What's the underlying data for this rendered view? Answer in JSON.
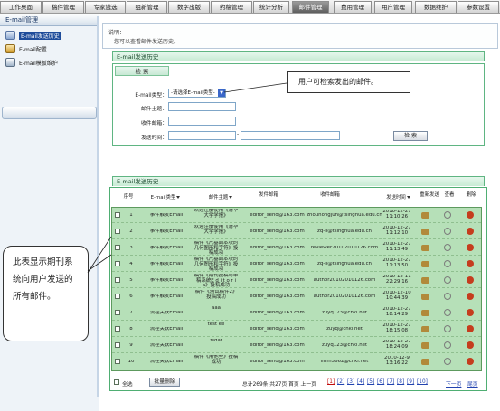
{
  "nav": {
    "tabs": [
      "工作桌面",
      "稿件管理",
      "专家遴选",
      "组新管理",
      "数字出版",
      "约稿管理",
      "统计分析",
      "邮件管理",
      "费用管理",
      "用户管理",
      "数据维护",
      "参数设置"
    ],
    "active": "邮件管理"
  },
  "sidebar": {
    "title": "E-mail管理",
    "items": [
      {
        "label": "E-mail发送历史",
        "icon": "history-icon",
        "active": true
      },
      {
        "label": "E-mail配置",
        "icon": "config-icon",
        "active": false
      },
      {
        "label": "E-mail模板维护",
        "icon": "template-icon",
        "active": false
      }
    ]
  },
  "notice": {
    "title": "说明：",
    "text": "您可以查看邮件发送历史。"
  },
  "section_title": "E-mail发送历史",
  "search": {
    "header": "检 索",
    "type_label": "E-mail类型：",
    "type_value": "-请选择E-mail类型-",
    "subject_label": "邮件主题：",
    "recipient_label": "收件邮箱：",
    "time_label": "发送时间：",
    "time_sep": "-",
    "button": "检 索"
  },
  "list": {
    "title": "E-mail发送历史",
    "headers": [
      "序号",
      "E-mail类型",
      "邮件主题",
      "发件邮箱",
      "收件邮箱",
      "发送时间",
      "重新发送",
      "查看",
      "删除"
    ],
    "rows": [
      {
        "no": "1",
        "type": "事件触发Email",
        "subject": "欢迎注册使用《清华大学学报》",
        "sender": "editor_send@163.com",
        "recipient": "zhouhongjun@tsinghua.edu.cn",
        "time": "2010-12-27 11:10:26"
      },
      {
        "no": "2",
        "type": "事件触发Email",
        "subject": "欢迎注册使用《清华大学学报》",
        "sender": "editor_send@163.com",
        "recipient": "zq-li@tsinghua.edu.cn",
        "time": "2010-12-27 11:12:10"
      },
      {
        "no": "3",
        "type": "事件触发Email",
        "subject": "稿件《尺基面本块的几何图形和字符》投稿成功",
        "sender": "editor_send@163.com",
        "recipient": "reviewer20102010126.com",
        "time": "2010-12-27 11:13:49"
      },
      {
        "no": "4",
        "type": "事件触发Email",
        "subject": "稿件《尺基面本块的几何图形和字符》投稿成功",
        "sender": "editor_send@163.com",
        "recipient": "zq-li@tsinghua.edu.cn",
        "time": "2010-12-27 11:13:50"
      },
      {
        "no": "5",
        "type": "事件触发Email",
        "subject": "稿件《期刊投稿与审稿系统E d i t o r i a》投稿成功",
        "sender": "editor_send@163.com",
        "recipient": "author20102010126.com",
        "time": "2010-12-11 22:29:16"
      },
      {
        "no": "6",
        "type": "事件触发Email",
        "subject": "稿件《测试稿件2》投稿成功",
        "sender": "editor_send@163.com",
        "recipient": "author20102010126.com",
        "time": "2010-12-10 10:44:39"
      },
      {
        "no": "7",
        "type": "流程关联Email",
        "subject": "aaa",
        "sender": "editor_send@163.com",
        "recipient": "zuyq123@cnki.net",
        "time": "2010-12-27 18:14:29"
      },
      {
        "no": "8",
        "type": "流程关联Email",
        "subject": "test ee",
        "sender": "editor_send@163.com",
        "recipient": "zuyq@cnki.net",
        "time": "2010-12-27 18:15:08"
      },
      {
        "no": "9",
        "type": "流程关联Email",
        "subject": "fsdaf",
        "sender": "editor_send@163.com",
        "recipient": "zuyq123@cnki.net",
        "time": "2010-12-27 18:24:09"
      },
      {
        "no": "10",
        "type": "流程关联Email",
        "subject": "稿件《用他些》投稿成功",
        "sender": "editor_send@163.com",
        "recipient": "lmm5662@cnki.net",
        "time": "2010-12-9 13:16:22"
      }
    ],
    "select_all": "全选",
    "bulk_delete": "批量删除",
    "pager_summary": "总计269条  共27页  首页  上一页",
    "pages": [
      "[1]",
      "[2]",
      "[3]",
      "[4]",
      "[5]",
      "[6]",
      "[7]",
      "[8]",
      "[9]",
      "[10]"
    ],
    "current_page": "[1]",
    "next": "下一页",
    "last": "尾页"
  },
  "annotations": {
    "top": "用户可检索发出的邮件。",
    "left": "此表显示期刊系统向用户发送的所有邮件。"
  },
  "colors": {
    "nav_active": "#6f6f6f",
    "panel_border": "#5fb582",
    "row_bg": "#b6e0b8",
    "sidebar_active": "#1e4c9a"
  }
}
